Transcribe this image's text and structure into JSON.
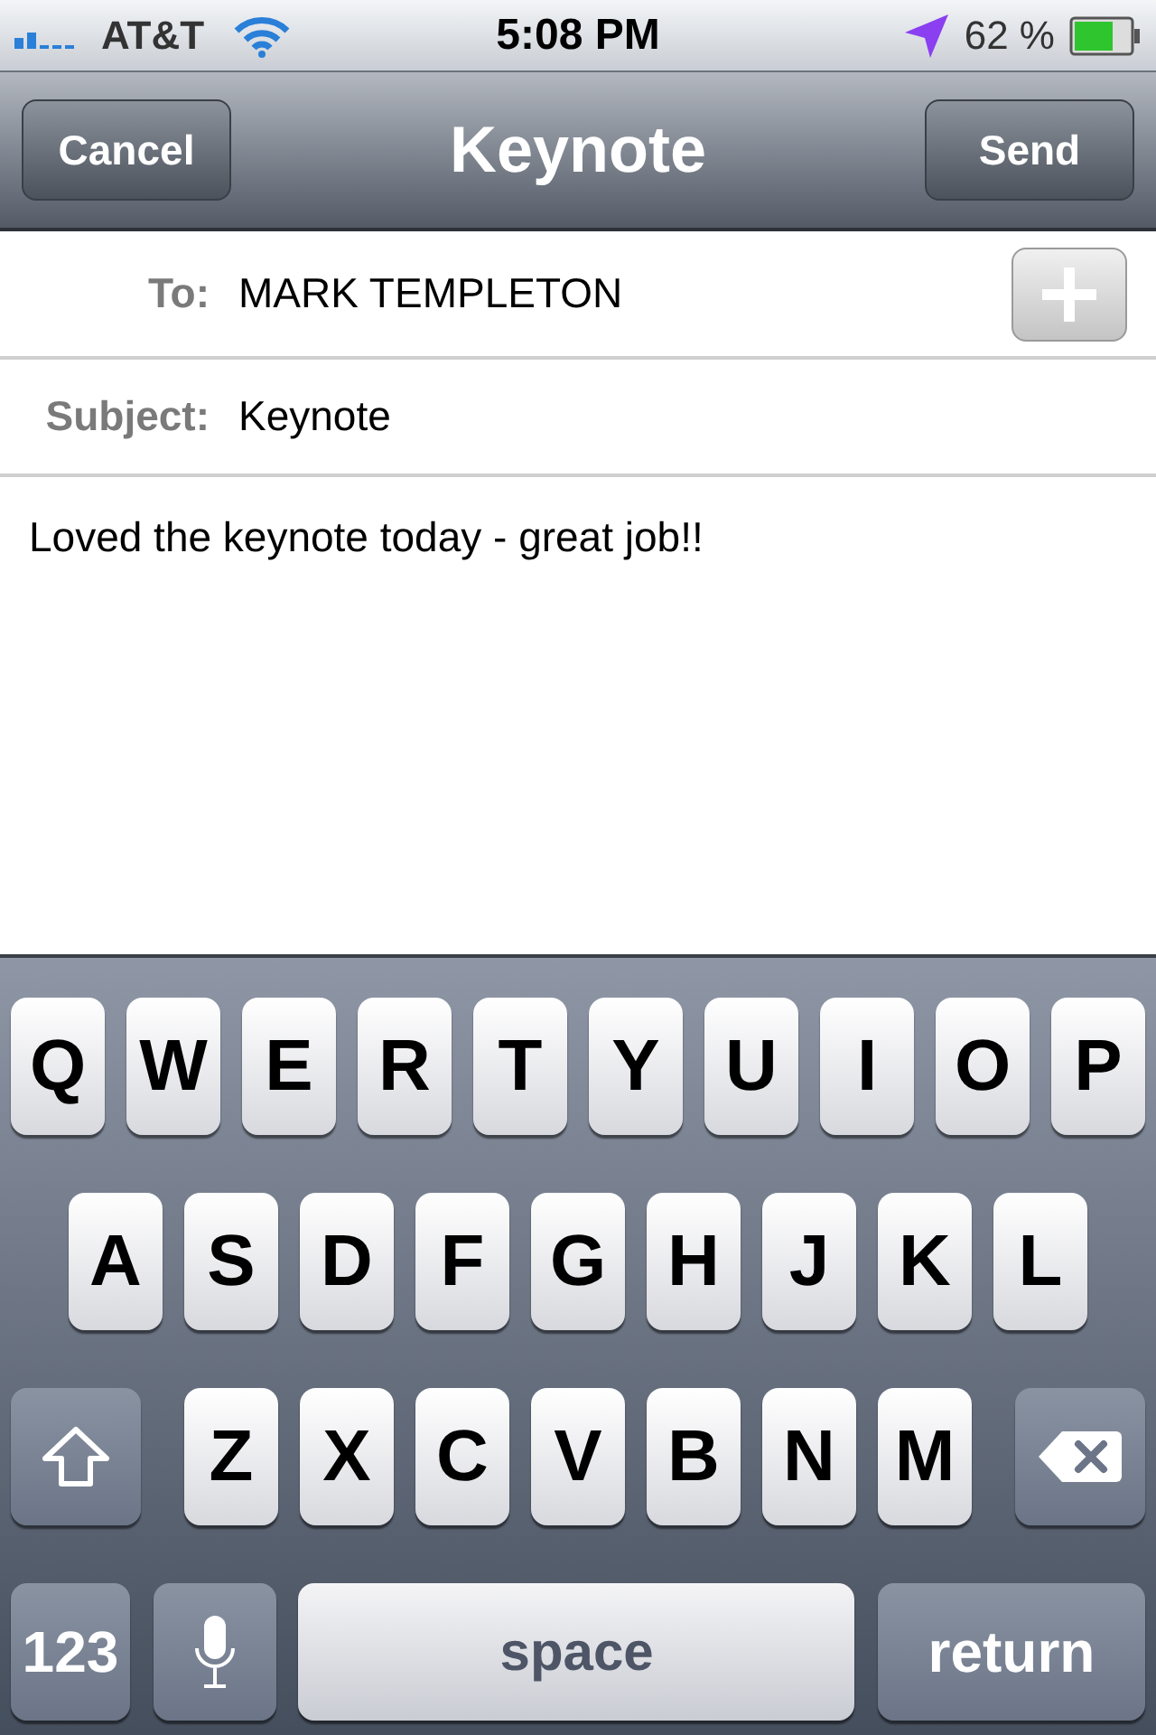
{
  "status_bar": {
    "carrier": "AT&T",
    "time": "5:08 PM",
    "battery": "62 %"
  },
  "nav": {
    "cancel": "Cancel",
    "title": "Keynote",
    "send": "Send"
  },
  "to": {
    "label": "To:",
    "value": "MARK TEMPLETON"
  },
  "subject": {
    "label": "Subject:",
    "value": "Keynote"
  },
  "body": "Loved the keynote today - great job!!",
  "keyboard": [
    [
      {
        "kind": "letter",
        "label": "Q"
      },
      {
        "kind": "letter",
        "label": "W"
      },
      {
        "kind": "letter",
        "label": "E"
      },
      {
        "kind": "letter",
        "label": "R"
      },
      {
        "kind": "letter",
        "label": "T"
      },
      {
        "kind": "letter",
        "label": "Y"
      },
      {
        "kind": "letter",
        "label": "U"
      },
      {
        "kind": "letter",
        "label": "I"
      },
      {
        "kind": "letter",
        "label": "O"
      },
      {
        "kind": "letter",
        "label": "P"
      }
    ],
    [
      {
        "kind": "letter",
        "label": "A"
      },
      {
        "kind": "letter",
        "label": "S"
      },
      {
        "kind": "letter",
        "label": "D"
      },
      {
        "kind": "letter",
        "label": "F"
      },
      {
        "kind": "letter",
        "label": "G"
      },
      {
        "kind": "letter",
        "label": "H"
      },
      {
        "kind": "letter",
        "label": "J"
      },
      {
        "kind": "letter",
        "label": "K"
      },
      {
        "kind": "letter",
        "label": "L"
      }
    ],
    [
      {
        "kind": "shift"
      },
      {
        "kind": "letter",
        "label": "Z"
      },
      {
        "kind": "letter",
        "label": "X"
      },
      {
        "kind": "letter",
        "label": "C"
      },
      {
        "kind": "letter",
        "label": "V"
      },
      {
        "kind": "letter",
        "label": "B"
      },
      {
        "kind": "letter",
        "label": "N"
      },
      {
        "kind": "letter",
        "label": "M"
      },
      {
        "kind": "delete"
      }
    ],
    [
      {
        "kind": "numbers",
        "label": "123"
      },
      {
        "kind": "mic"
      },
      {
        "kind": "space",
        "label": "space"
      },
      {
        "kind": "return",
        "label": "return"
      }
    ]
  ]
}
